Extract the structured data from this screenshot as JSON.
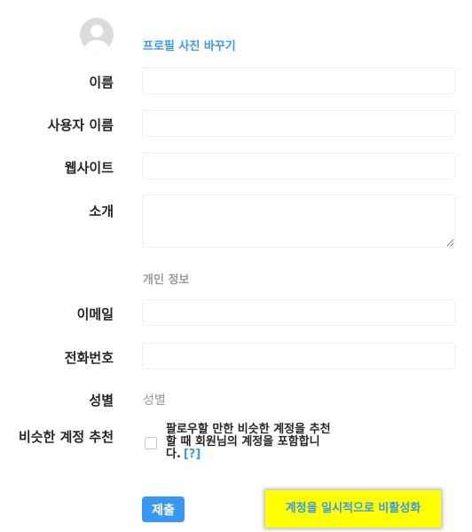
{
  "profile": {
    "change_photo_label": "프로필 사진 바꾸기",
    "avatar_icon": "default-avatar-icon"
  },
  "form": {
    "name_label": "이름",
    "name_value": "",
    "username_label": "사용자 이름",
    "username_value": "",
    "website_label": "웹사이트",
    "website_value": "",
    "bio_label": "소개",
    "bio_value": "",
    "private_info_title": "개인 정보",
    "email_label": "이메일",
    "email_value": "",
    "phone_label": "전화번호",
    "phone_value": "",
    "gender_label": "성별",
    "gender_value": "성별",
    "suggestions_label": "비슷한 계정 추천",
    "suggestions_text": "팔로우할 만한 비슷한 계정을 추천할 때 회원님의 계정을 포함합니다.",
    "suggestions_help": "[?]",
    "suggestions_checked": false
  },
  "actions": {
    "submit_label": "제출",
    "deactivate_label": "계정을 일시적으로 비활성화"
  },
  "colors": {
    "accent": "#3897f0",
    "deactivate_bg": "#ffff00",
    "border": "#efefef",
    "muted_text": "#999999"
  }
}
